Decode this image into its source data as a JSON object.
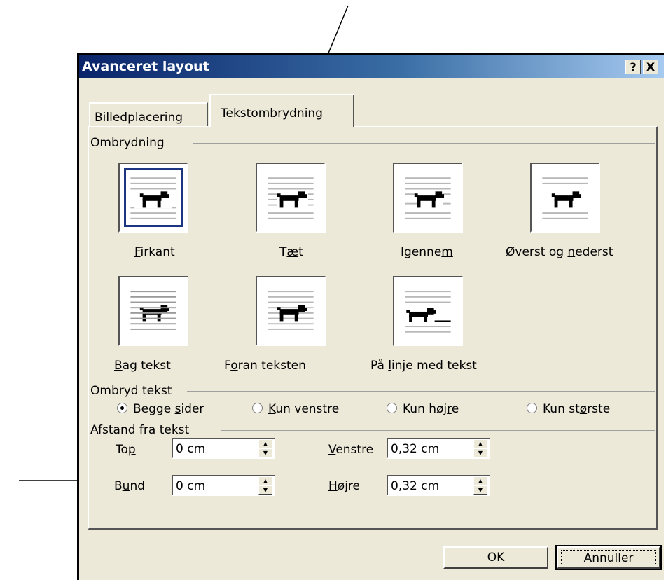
{
  "window": {
    "title": "Avanceret layout",
    "help_button": "?",
    "close_button": "X"
  },
  "tabs": [
    {
      "label": "Billedplacering",
      "active": false
    },
    {
      "label": "Tekstombrydning",
      "active": true
    }
  ],
  "wrapping": {
    "group_label": "Ombrydning",
    "styles": [
      {
        "pre": "",
        "key": "F",
        "post": "irkant",
        "icon": "dog-square-icon",
        "selected": true
      },
      {
        "pre": "T",
        "key": "æ",
        "post": "t",
        "icon": "dog-tight-icon",
        "selected": false
      },
      {
        "pre": "Igenne",
        "key": "m",
        "post": "",
        "icon": "dog-through-icon",
        "selected": false
      },
      {
        "pre": "Øverst og ",
        "key": "n",
        "post": "ederst",
        "icon": "dog-top-bottom-icon",
        "selected": false
      },
      {
        "pre": "",
        "key": "B",
        "post": "ag tekst",
        "icon": "dog-behind-text-icon",
        "selected": false
      },
      {
        "pre": "F",
        "key": "o",
        "post": "ran teksten",
        "icon": "dog-in-front-icon",
        "selected": false
      },
      {
        "pre": "På ",
        "key": "l",
        "post": "inje med tekst",
        "icon": "dog-inline-icon",
        "selected": false
      }
    ]
  },
  "wrap_text": {
    "group_label": "Ombryd tekst",
    "options": [
      {
        "pre": "Begge ",
        "key": "s",
        "post": "ider",
        "checked": true
      },
      {
        "pre": "",
        "key": "K",
        "post": "un venstre",
        "checked": false
      },
      {
        "pre": "Kun høj",
        "key": "r",
        "post": "e",
        "checked": false
      },
      {
        "pre": "Kun st",
        "key": "ø",
        "post": "rste",
        "checked": false
      }
    ]
  },
  "distance": {
    "group_label": "Afstand fra tekst",
    "top": {
      "pre": "To",
      "key": "p",
      "post": "",
      "value": "0 cm"
    },
    "bottom": {
      "pre": "B",
      "key": "u",
      "post": "nd",
      "value": "0 cm"
    },
    "left": {
      "pre": "",
      "key": "V",
      "post": "enstre",
      "value": "0,32 cm"
    },
    "right": {
      "pre": "",
      "key": "H",
      "post": "øjre",
      "value": "0,32 cm"
    }
  },
  "buttons": {
    "ok": "OK",
    "cancel": "Annuller"
  },
  "colors": {
    "dialog_face": "#ece9d8",
    "title_gradient_start": "#0a246a",
    "title_gradient_end": "#a6caf0",
    "selection_outline": "#1c3580"
  }
}
